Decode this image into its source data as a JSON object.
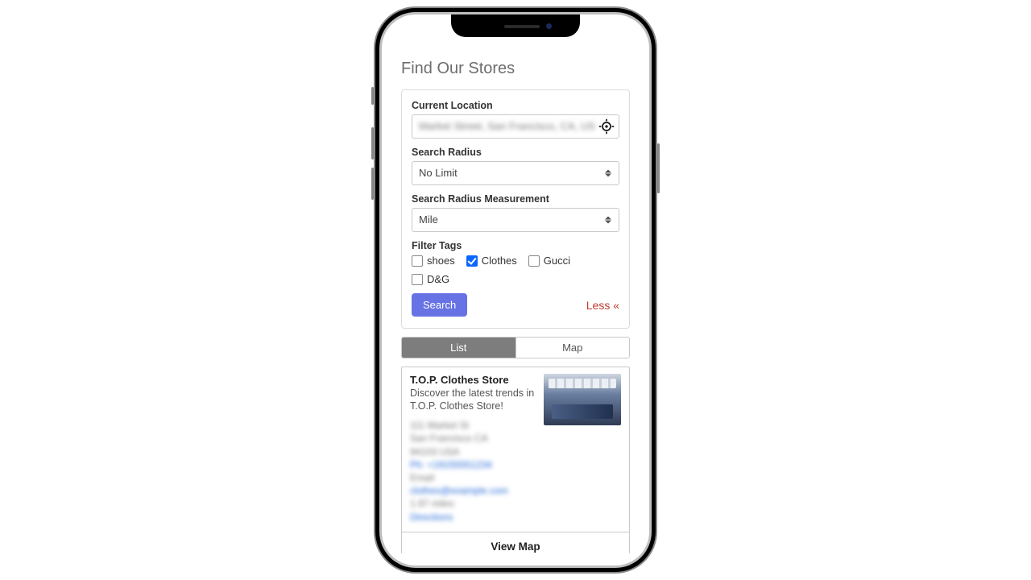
{
  "page": {
    "title": "Find Our Stores"
  },
  "form": {
    "location_label": "Current Location",
    "location_placeholder_obscured": "Market Street, San Francisco, CA, USA",
    "radius_label": "Search Radius",
    "radius_value": "No Limit",
    "radius_unit_label": "Search Radius Measurement",
    "radius_unit_value": "Mile",
    "filter_tags_label": "Filter Tags",
    "tags": [
      {
        "label": "shoes",
        "checked": false
      },
      {
        "label": "Clothes",
        "checked": true
      },
      {
        "label": "Gucci",
        "checked": false
      },
      {
        "label": "D&G",
        "checked": false
      }
    ],
    "search_btn": "Search",
    "less_link": "Less «"
  },
  "tabs": {
    "list": "List",
    "map": "Map",
    "active": "list"
  },
  "results": [
    {
      "title": "T.O.P. Clothes Store",
      "desc": "Discover the latest trends in T.O.P. Clothes Store!",
      "details_obscured": {
        "addr1": "111 Market St",
        "addr2": "San Francisco CA",
        "addr3": "94103 USA",
        "phone": "Ph: +19155551234",
        "email_label": "Email",
        "email": "clothes@example.com",
        "distance": "1.97 miles",
        "directions": "Directions"
      }
    }
  ],
  "footer": {
    "view_map": "View Map"
  },
  "icons": {
    "gps": "gps-fixed-icon",
    "select": "up-down-caret-icon"
  }
}
